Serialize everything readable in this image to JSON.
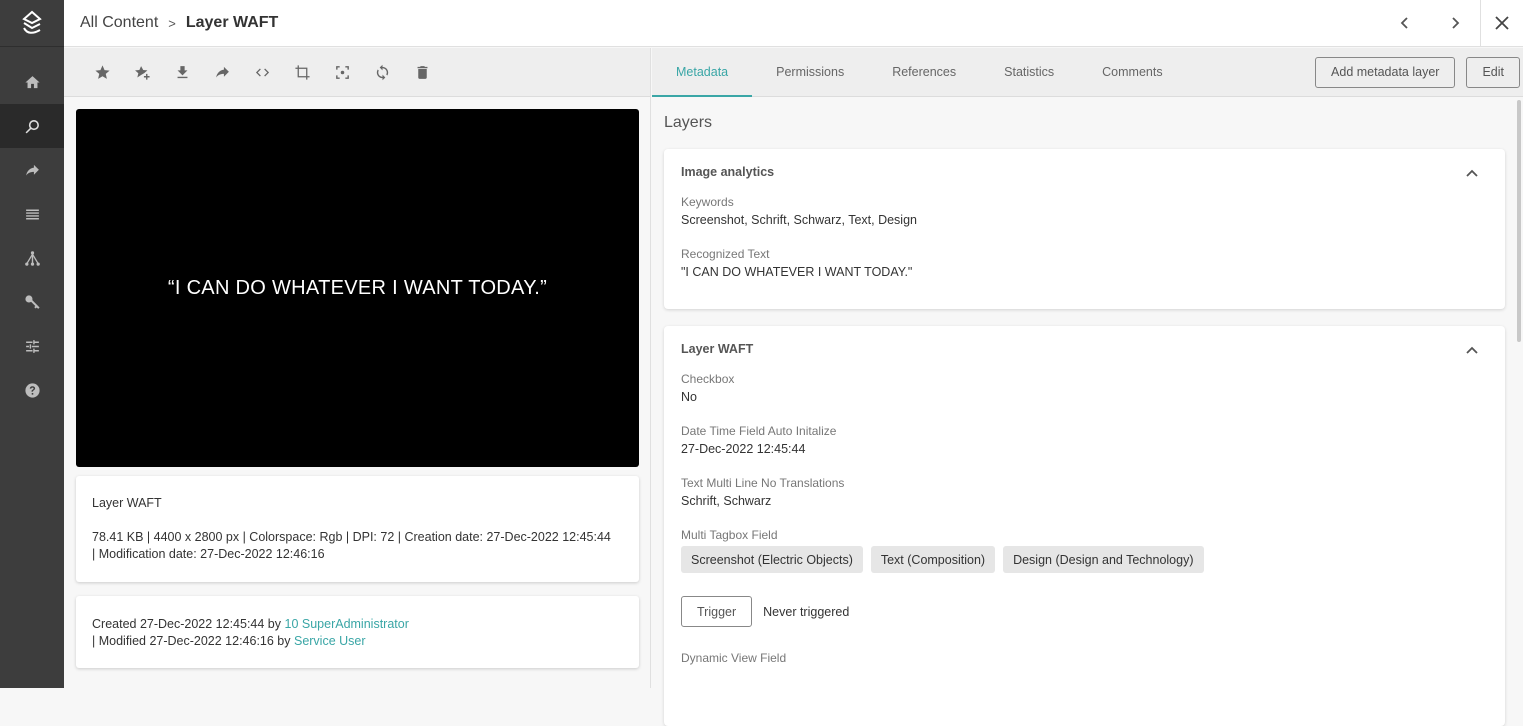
{
  "sidebar": {
    "items": [
      {
        "name": "home",
        "active": false
      },
      {
        "name": "search",
        "active": true
      },
      {
        "name": "share",
        "active": false
      },
      {
        "name": "list",
        "active": false
      },
      {
        "name": "hierarchy",
        "active": false
      },
      {
        "name": "key",
        "active": false
      },
      {
        "name": "settings",
        "active": false
      },
      {
        "name": "help",
        "active": false
      }
    ]
  },
  "breadcrumb": {
    "root": "All Content",
    "separator": ">",
    "current": "Layer WAFT"
  },
  "toolbar": {
    "icons": [
      "favorite-icon",
      "add-favorite-icon",
      "download-icon",
      "share-icon",
      "embed-code-icon",
      "crop-icon",
      "focal-point-icon",
      "refresh-icon",
      "delete-icon"
    ]
  },
  "preview": {
    "text": "“I CAN DO WHATEVER I WANT TODAY.”"
  },
  "info_card": {
    "name": "Layer WAFT",
    "details_line1": "78.41 KB | 4400 x 2800 px | Colorspace: Rgb | DPI: 72 | Creation date: 27-Dec-2022 12:45:44",
    "details_line2": "| Modification date: 27-Dec-2022 12:46:16"
  },
  "audit_card": {
    "created_prefix": "Created 27-Dec-2022 12:45:44 by ",
    "created_by": "10 SuperAdministrator",
    "modified_prefix": "| Modified 27-Dec-2022 12:46:16 by ",
    "modified_by": "Service User"
  },
  "tabs": [
    {
      "label": "Metadata",
      "active": true
    },
    {
      "label": "Permissions",
      "active": false
    },
    {
      "label": "References",
      "active": false
    },
    {
      "label": "Statistics",
      "active": false
    },
    {
      "label": "Comments",
      "active": false
    }
  ],
  "actions": {
    "add_layer": "Add metadata layer",
    "edit": "Edit"
  },
  "layers_title": "Layers",
  "image_analytics": {
    "title": "Image analytics",
    "keywords_label": "Keywords",
    "keywords_value": "Screenshot, Schrift, Schwarz, Text, Design",
    "recognized_label": "Recognized Text",
    "recognized_value": "\"I CAN DO WHATEVER I WANT TODAY.\""
  },
  "layer_waft": {
    "title": "Layer WAFT",
    "checkbox_label": "Checkbox",
    "checkbox_value": "No",
    "datetime_label": "Date Time Field Auto Initalize",
    "datetime_value": "27-Dec-2022 12:45:44",
    "multiline_label": "Text Multi Line No Translations",
    "multiline_value": "Schrift, Schwarz",
    "tagbox_label": "Multi Tagbox Field",
    "tags": [
      "Screenshot (Electric Objects)",
      "Text (Composition)",
      "Design (Design and Technology)"
    ],
    "trigger_label": "Trigger",
    "trigger_status": "Never triggered",
    "dynamic_label": "Dynamic View Field"
  },
  "colors": {
    "accent": "#3aa6a6",
    "sidebar": "#3d3d3d"
  }
}
